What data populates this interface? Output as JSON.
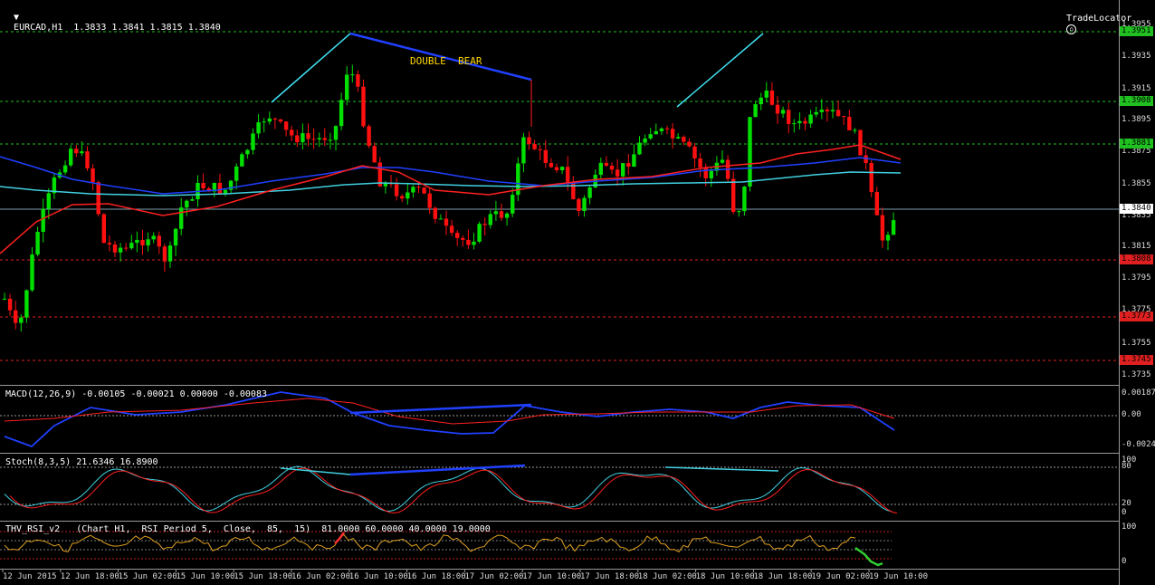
{
  "main": {
    "symbol_header": "EURCAD,H1  1.3833 1.3841 1.3815 1.3840",
    "brand": "TradeLocator",
    "annotation": "DOUBLE  BEAR",
    "price_ticks": [
      "1.3955",
      "1.3935",
      "1.3915",
      "1.3895",
      "1.3875",
      "1.3855",
      "1.3835",
      "1.3815",
      "1.3795",
      "1.3775",
      "1.3755",
      "1.3735"
    ],
    "level_labels": [
      {
        "text": "1.3951",
        "color": "#20c020"
      },
      {
        "text": "1.3908",
        "color": "#20c020"
      },
      {
        "text": "1.3881",
        "color": "#20c020"
      },
      {
        "text": "1.3840",
        "color": "#ffffff"
      },
      {
        "text": "1.3808",
        "color": "#e02020"
      },
      {
        "text": "1.3773",
        "color": "#e02020"
      },
      {
        "text": "1.3745",
        "color": "#e02020"
      }
    ]
  },
  "macd": {
    "header": "MACD(12,26,9) -0.00105 -0.00021 0.00000 -0.00083",
    "ticks": [
      "0.00187",
      "0.00",
      "-0.00241"
    ]
  },
  "stoch": {
    "header": "Stoch(8,3,5) 21.6346 16.8900",
    "ticks": [
      "100",
      "80",
      "20",
      "0"
    ]
  },
  "rsi": {
    "header": "THV_RSI_v2   (Chart H1,  RSI Period 5,  Close,  85,  15)  81.0000 60.0000 40.0000 19.0000",
    "ticks": [
      "100",
      "0"
    ]
  },
  "time_labels": [
    "12 Jun 2015",
    "12 Jun 18:00",
    "15 Jun 02:00",
    "15 Jun 10:00",
    "15 Jun 18:00",
    "16 Jun 02:00",
    "16 Jun 10:00",
    "16 Jun 18:00",
    "17 Jun 02:00",
    "17 Jun 10:00",
    "17 Jun 18:00",
    "18 Jun 02:00",
    "18 Jun 10:00",
    "18 Jun 18:00",
    "19 Jun 02:00",
    "19 Jun 10:00"
  ]
}
